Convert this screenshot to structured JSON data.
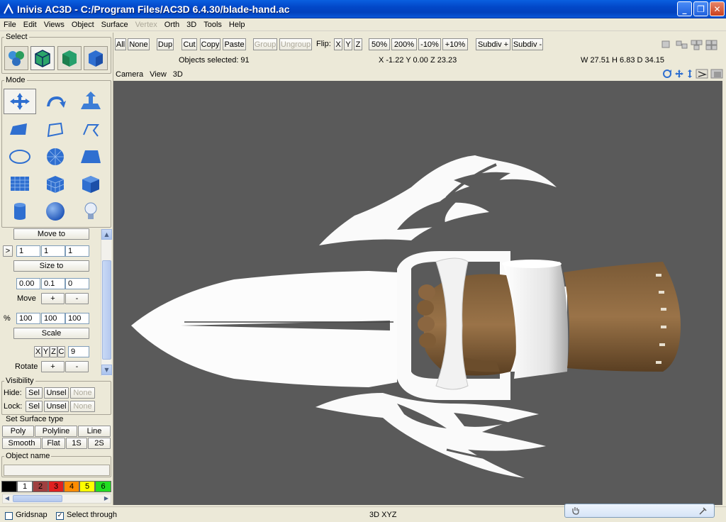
{
  "window": {
    "title": "Inivis AC3D - C:/Program Files/AC3D 6.4.30/blade-hand.ac",
    "controls": {
      "minimize": "_",
      "maximize": "❐",
      "close": "✕"
    }
  },
  "menubar": {
    "items": [
      {
        "label": "File",
        "enabled": true
      },
      {
        "label": "Edit",
        "enabled": true
      },
      {
        "label": "Views",
        "enabled": true
      },
      {
        "label": "Object",
        "enabled": true
      },
      {
        "label": "Surface",
        "enabled": true
      },
      {
        "label": "Vertex",
        "enabled": false
      },
      {
        "label": "Orth",
        "enabled": true
      },
      {
        "label": "3D",
        "enabled": true
      },
      {
        "label": "Tools",
        "enabled": true
      },
      {
        "label": "Help",
        "enabled": true
      }
    ]
  },
  "left_panel": {
    "select_label": "Select",
    "mode_label": "Mode",
    "move_to": "Move to",
    "arrow_btn": ">",
    "move_to_values": [
      "1",
      "1",
      "1"
    ],
    "size_to": "Size to",
    "size_values": [
      "0.00",
      "0.1",
      "0"
    ],
    "move_label": "Move",
    "plus": "+",
    "minus": "-",
    "percent_label": "%",
    "scale_values": [
      "100",
      "100",
      "100"
    ],
    "scale": "Scale",
    "axes": [
      "X",
      "Y",
      "Z",
      "C"
    ],
    "rotate_value": "9",
    "rotate_label": "Rotate",
    "visibility_label": "Visibility",
    "hide_label": "Hide:",
    "lock_label": "Lock:",
    "sel": "Sel",
    "unsel": "Unsel",
    "none": "None",
    "surface_type_label": "Set Surface type",
    "poly": "Poly",
    "polyline": "Polyline",
    "line": "Line",
    "smooth": "Smooth",
    "flat": "Flat",
    "one_s": "1S",
    "two_s": "2S",
    "object_name_label": "Object name",
    "object_name_value": "",
    "palette": [
      {
        "label": "",
        "color": "#000000",
        "text": "#ffffff"
      },
      {
        "label": "1",
        "color": "#ffffff",
        "text": "#000000"
      },
      {
        "label": "2",
        "color": "#a04040",
        "text": "#000000"
      },
      {
        "label": "3",
        "color": "#e02020",
        "text": "#000000"
      },
      {
        "label": "4",
        "color": "#ff8c00",
        "text": "#000000"
      },
      {
        "label": "5",
        "color": "#ffff00",
        "text": "#000000"
      },
      {
        "label": "6",
        "color": "#22dd22",
        "text": "#000000"
      }
    ]
  },
  "toolbar": {
    "all": "All",
    "none": "None",
    "dup": "Dup",
    "cut": "Cut",
    "copy": "Copy",
    "paste": "Paste",
    "group": "Group",
    "ungroup": "Ungroup",
    "flip_label": "Flip:",
    "x": "X",
    "y": "Y",
    "z": "Z",
    "zoom50": "50%",
    "zoom200": "200%",
    "zoom_minus": "-10%",
    "zoom_plus": "+10%",
    "subdiv_plus": "Subdiv +",
    "subdiv_minus": "Subdiv -"
  },
  "info": {
    "objects_selected": "Objects selected: 91",
    "coords": "X -1.22 Y 0.00 Z 23.23",
    "dims": "W 27.51 H 6.83 D 34.15"
  },
  "viewport": {
    "menu": [
      "Camera",
      "View",
      "3D"
    ],
    "background": "#5a5a5a"
  },
  "status": {
    "gridsnap": "Gridsnap",
    "gridsnap_checked": false,
    "select_through": "Select through",
    "select_through_checked": true,
    "view_mode": "3D XYZ"
  }
}
